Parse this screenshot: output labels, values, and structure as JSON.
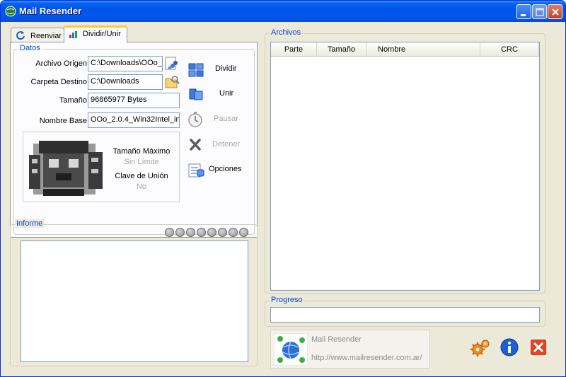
{
  "window": {
    "title": "Mail Resender"
  },
  "tabs": [
    {
      "label": "Reenviar",
      "active": false
    },
    {
      "label": "Dividir/Unir",
      "active": true
    }
  ],
  "datos": {
    "legend": "Datos",
    "archivo_origen_label": "Archivo Origen",
    "archivo_origen_value": "C:\\Downloads\\OOo_",
    "carpeta_destino_label": "Carpeta Destino",
    "carpeta_destino_value": "C:\\Downloads",
    "tamano_label": "Tamaño",
    "tamano_value": "96865977 Bytes",
    "nombre_base_label": "Nombre Base",
    "nombre_base_value": "OOo_2.0.4_Win32Intel_in",
    "tamano_maximo_label": "Tamaño Máximo",
    "tamano_maximo_value": "Sin Límite",
    "clave_union_label": "Clave de Unión",
    "clave_union_value": "No"
  },
  "actions": {
    "dividir": "Dividir",
    "unir": "Unir",
    "pausar": "Pausar",
    "detener": "Detener",
    "opciones": "Opciones"
  },
  "informe": {
    "legend": "Informe",
    "indicator_count": 8
  },
  "archivos": {
    "legend": "Archivos",
    "columns": [
      "Parte",
      "Tamaño",
      "Nombre",
      "CRC"
    ],
    "rows": []
  },
  "progreso": {
    "legend": "Progreso",
    "value": 0
  },
  "about": {
    "name": "Mail Resender",
    "url": "http://www.mailresender.com.ar/"
  },
  "colors": {
    "legend": "#0046d5",
    "titlebar": "#0055e5",
    "close": "#c3411d"
  }
}
